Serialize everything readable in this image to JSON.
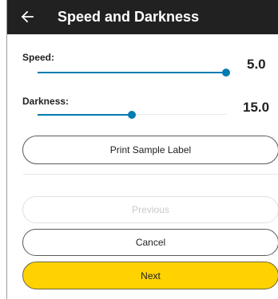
{
  "header": {
    "title": "Speed and Darkness",
    "back_icon": "arrow-left-icon"
  },
  "speed": {
    "label": "Speed:",
    "value": "5.0",
    "slider_level": 1.0
  },
  "darkness": {
    "label": "Darkness:",
    "value": "15.0",
    "slider_level": 0.5
  },
  "buttons": {
    "print_sample": "Print Sample Label",
    "previous": "Previous",
    "cancel": "Cancel",
    "next": "Next"
  },
  "colors": {
    "appbar": "#212121",
    "accent": "#007cb0",
    "primary_button": "#ffd200"
  }
}
